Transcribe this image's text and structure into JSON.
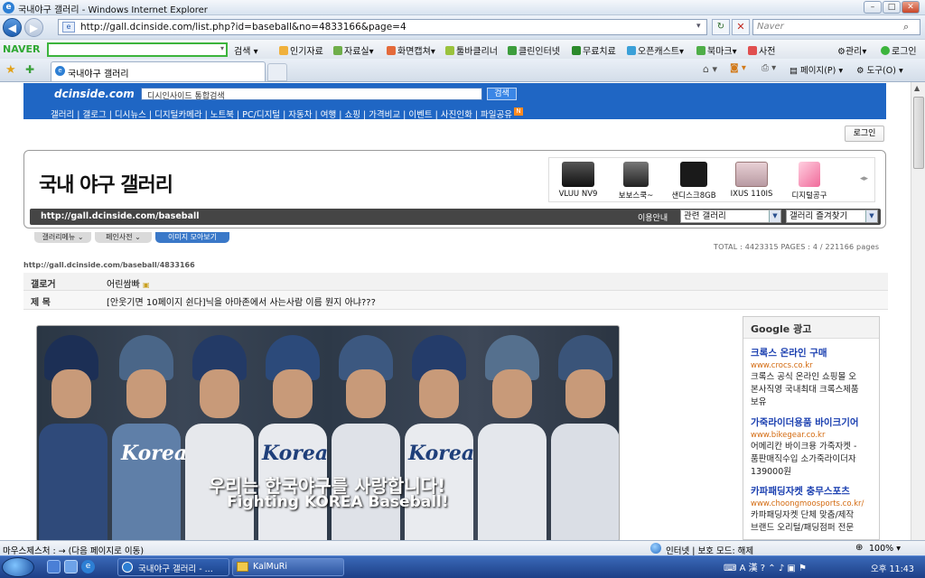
{
  "window": {
    "title": "국내야구 갤러리 - Windows Internet Explorer",
    "buttons": [
      "minimize",
      "maximize",
      "close"
    ]
  },
  "navigation": {
    "url": "http://gall.dcinside.com/list.php?id=baseball&no=4833166&page=4",
    "search_placeholder": "Naver"
  },
  "naver_toolbar": {
    "logo": "NAVER",
    "items": [
      "검색",
      "인기자료",
      "자료실",
      "화면캡쳐",
      "툴바클리너",
      "클린인터넷",
      "무료치료",
      "오픈캐스트",
      "북마크",
      "사전",
      "관리",
      "로그인"
    ]
  },
  "tabs": {
    "active_tab": "국내야구 갤러리",
    "tools": [
      "페이지(P)",
      "도구(O)"
    ]
  },
  "dc_header": {
    "logo": "dcinside.com",
    "search_placeholder": "디시인사이드 통합검색",
    "search_button": "검색",
    "menu": "갤러리 | 갤로그 | 디시뉴스 | 디지털카메라 | 노트북 | PC/디지털 | 자동차 | 여행 | 쇼핑 | 가격비교 | 이벤트 | 사진인화 | 파일공유"
  },
  "login_button": "로그인",
  "gallery": {
    "title": "국내 야구 갤러리",
    "products": [
      "VLUU NV9",
      "보보스쿡~",
      "샌디스크8GB",
      "IXUS 110IS",
      "디지털공구"
    ],
    "url": "http://gall.dcinside.com/baseball",
    "guide_label": "이용안내",
    "select_related": "관련 갤러리",
    "select_favorites": "갤러리 즐겨찾기",
    "subtabs": [
      "갤러리메뉴",
      "페인사전",
      "이미지 모아보기"
    ]
  },
  "stats": "TOTAL : 4423315 PAGES : 4 / 221166 pages",
  "post": {
    "permalink": "http://gall.dcinside.com/baseball/4833166",
    "author_label": "갤로거",
    "author": "어린쌈빠",
    "subject_label": "제 목",
    "subject": "[안웃기면 10페이지 쉰다]닉을 아마존에서 사는사람 이름 뭔지 아냐???"
  },
  "banner": {
    "slogan_ko": "우리는 한국야구를 사랑합니다!",
    "slogan_en": "Fighting KOREA Baseball!",
    "jersey_text": "Korea"
  },
  "ads": {
    "header": "Google 광고",
    "items": [
      {
        "title": "크록스 온라인 구매",
        "url": "www.crocs.co.kr",
        "desc": [
          "크록스 공식 온라인 쇼핑몰 오",
          "본사직영 국내최대 크록스제품",
          "보유"
        ]
      },
      {
        "title": "가죽라이더용품 바이크기어",
        "url": "www.bikegear.co.kr",
        "desc": [
          "어메리칸 바이크용 가죽자켓 -",
          "품판매직수입 소가죽라이더자",
          "139000원"
        ]
      },
      {
        "title": "카파패딩자켓 충무스포츠",
        "url": "www.choongmoosports.co.kr/",
        "desc": [
          "카파패딩자켓 단체 맞춤/제작",
          "브랜드 오리털/패딩점퍼 전문"
        ]
      }
    ]
  },
  "statusbar": {
    "text": "마우스제스처 : → (다음 페이지로 이동)",
    "zone": "인터넷 | 보호 모드: 해제",
    "zoom": "100%"
  },
  "taskbar": {
    "windows": [
      "국내야구 갤러리 - ...",
      "KalMuRi"
    ],
    "clock": "오후 11:43"
  }
}
